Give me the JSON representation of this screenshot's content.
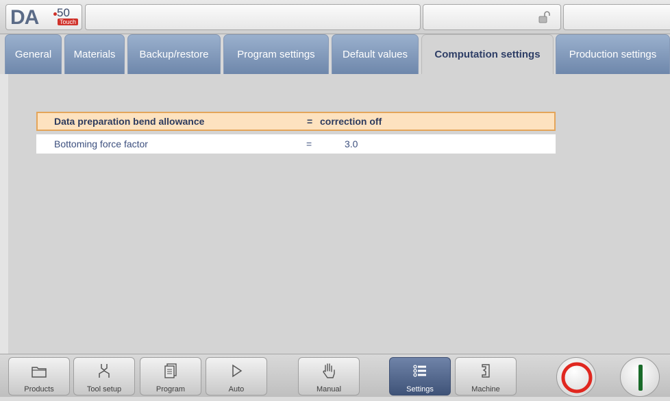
{
  "app": {
    "logo_text": "DA",
    "logo_number": "50",
    "logo_badge": "Touch"
  },
  "tabs": [
    {
      "label": "General",
      "active": false
    },
    {
      "label": "Materials",
      "active": false
    },
    {
      "label": "Backup/restore",
      "active": false
    },
    {
      "label": "Program settings",
      "active": false
    },
    {
      "label": "Default values",
      "active": false
    },
    {
      "label": "Computation settings",
      "active": true
    },
    {
      "label": "Production settings",
      "active": false
    }
  ],
  "settings": [
    {
      "label": "Data preparation bend allowance",
      "eq": "=",
      "value": "correction off",
      "selected": true
    },
    {
      "label": "Bottoming force factor",
      "eq": "=",
      "value": "3.0",
      "selected": false
    }
  ],
  "nav": [
    {
      "label": "Products",
      "icon": "folder-icon"
    },
    {
      "label": "Tool setup",
      "icon": "tool-setup-icon"
    },
    {
      "label": "Program",
      "icon": "program-icon"
    },
    {
      "label": "Auto",
      "icon": "play-icon"
    },
    {
      "label": "Manual",
      "icon": "hand-icon"
    },
    {
      "label": "Settings",
      "icon": "settings-list-icon",
      "active": true
    },
    {
      "label": "Machine",
      "icon": "machine-icon"
    }
  ],
  "colors": {
    "tab_inactive": "#7f97bb",
    "selected_row_bg": "#fde2bf",
    "selected_row_border": "#e4a55a",
    "stop_red": "#e0271f",
    "start_green": "#1a6b2a"
  }
}
